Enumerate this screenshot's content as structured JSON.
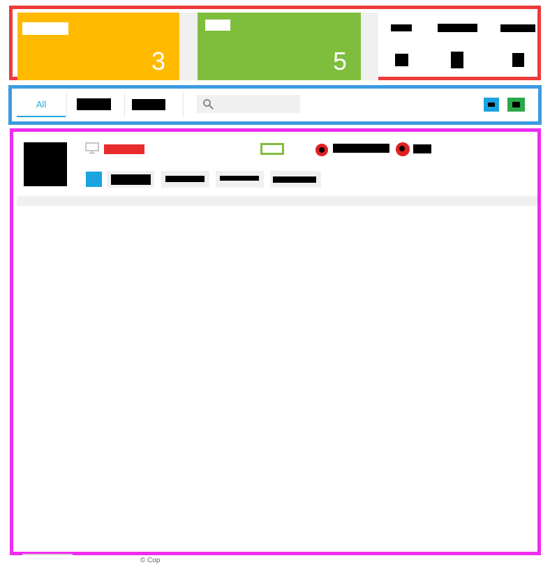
{
  "stats": {
    "orange_value": "3",
    "green_value": "5"
  },
  "toolbar": {
    "tabs": [
      {
        "label": "All",
        "active": true
      }
    ],
    "search": {
      "placeholder": ""
    }
  },
  "footer": {
    "text": "© Cop"
  },
  "colors": {
    "orange_tile": "#ffba00",
    "green_tile": "#7fbd3d",
    "accent": "#21a8d9",
    "blue_button": "#1aa3e0",
    "green_button": "#2aa84a",
    "status_red": "#e02020",
    "monitor_red": "#e82c2c"
  },
  "icons": {
    "search": "search-icon",
    "monitor": "monitor-icon",
    "battery": "battery-icon"
  }
}
